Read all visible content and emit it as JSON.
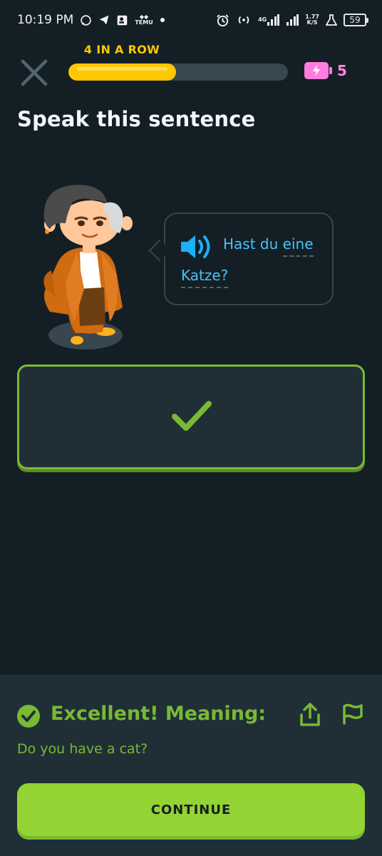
{
  "status_bar": {
    "time": "10:19 PM",
    "icons_left": [
      "whatsapp-icon",
      "telegram-icon",
      "contact-card-icon",
      "temu-icon",
      "dot-icon"
    ],
    "temu_label": "TEMU",
    "network_label": "4G",
    "speed_value": "1.77",
    "speed_unit": "K/S",
    "battery": "59"
  },
  "lesson": {
    "streak_label": "4 IN A ROW",
    "progress": 0.49,
    "energy_count": "5",
    "colors": {
      "progress": "#ffc800",
      "energy": "#ff7de0",
      "success": "#79b933"
    }
  },
  "title": "Speak this sentence",
  "bubble": {
    "words_line1": [
      "Hast",
      "du",
      "eine"
    ],
    "words_line2": [
      "Katze?"
    ]
  },
  "feedback": {
    "title": "Excellent! Meaning:",
    "meaning": "Do you have a cat?",
    "continue_label": "CONTINUE"
  }
}
